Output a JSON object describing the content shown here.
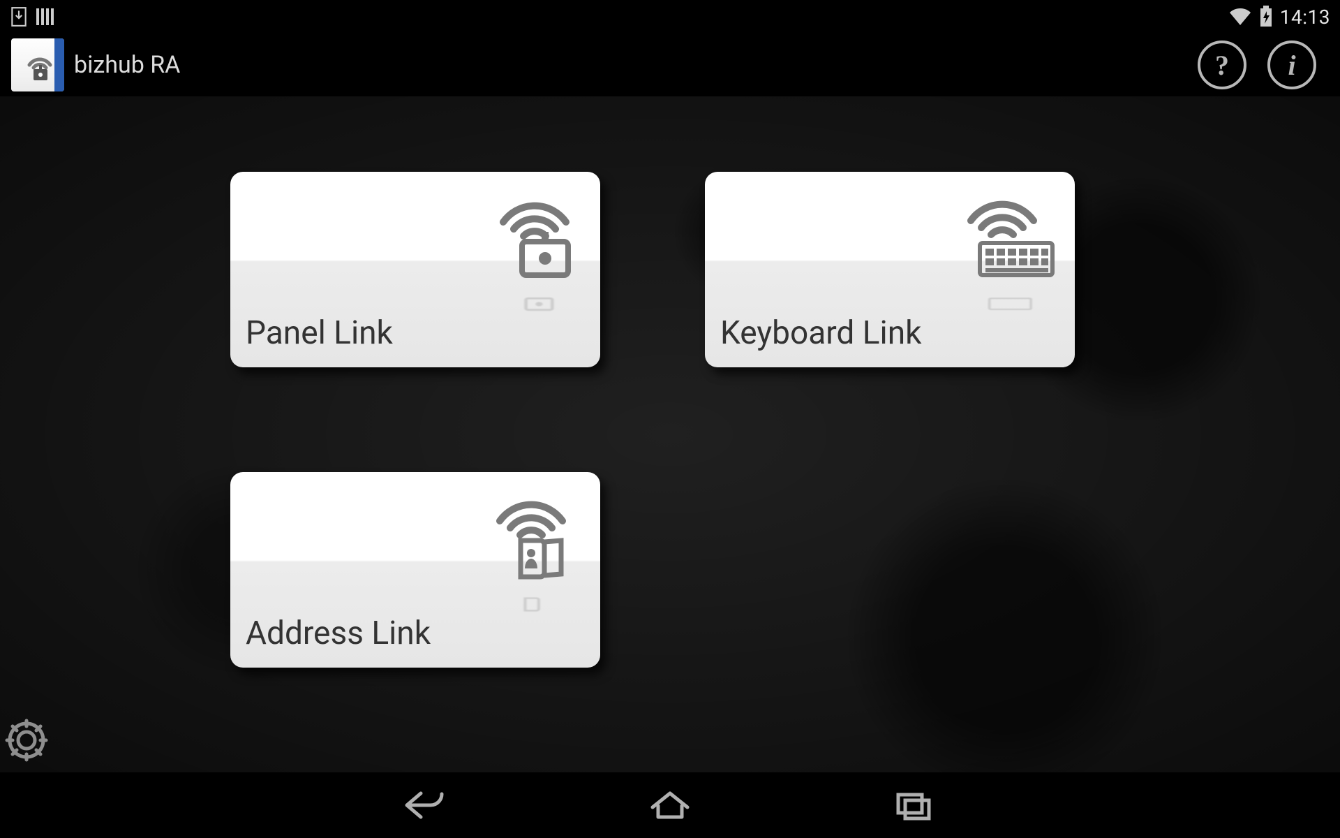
{
  "status": {
    "time": "14:13"
  },
  "app": {
    "title": "bizhub RA"
  },
  "tiles": [
    {
      "label": "Panel Link",
      "icon": "panel"
    },
    {
      "label": "Keyboard Link",
      "icon": "keyboard"
    },
    {
      "label": "Address Link",
      "icon": "address"
    }
  ]
}
